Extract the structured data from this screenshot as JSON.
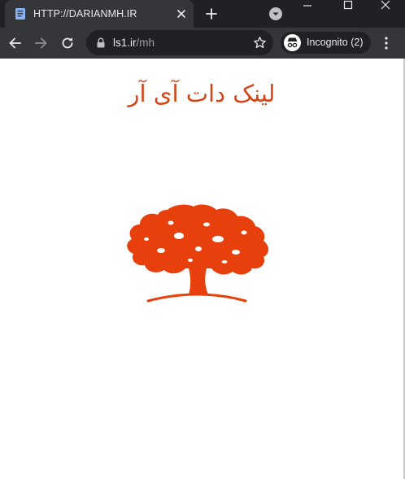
{
  "browser": {
    "tab": {
      "title": "HTTP://DARIANMH.IR",
      "favicon_icon": "document-icon",
      "close_icon": "close-icon"
    },
    "new_tab_icon": "plus-icon",
    "tab_search_icon": "chevron-down-icon",
    "window_controls": [
      "minimize-icon",
      "maximize-icon",
      "close-icon"
    ],
    "nav": {
      "back_icon": "arrow-left-icon",
      "forward_icon": "arrow-right-icon",
      "reload_icon": "reload-icon"
    },
    "address": {
      "lock_icon": "lock-icon",
      "host": "ls1.ir",
      "path": "/mh",
      "bookmark_icon": "star-icon"
    },
    "incognito": {
      "label": "Incognito (2)",
      "icon": "incognito-icon"
    },
    "menu_icon": "kebab-menu-icon"
  },
  "page": {
    "heading": "لینک دات آی آر",
    "logo": "tree-logo",
    "accent_color": "#e8400c",
    "heading_color": "#d4461a"
  }
}
